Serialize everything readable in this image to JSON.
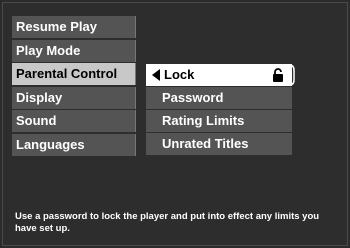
{
  "main_menu": {
    "items": [
      {
        "label": "Resume Play"
      },
      {
        "label": "Play Mode"
      },
      {
        "label": "Parental Control",
        "active": true
      },
      {
        "label": "Display"
      },
      {
        "label": "Sound"
      },
      {
        "label": "Languages"
      }
    ]
  },
  "sub_menu": {
    "items": [
      {
        "label": "Lock",
        "selected": true,
        "icon": "lock-icon"
      },
      {
        "label": "Password"
      },
      {
        "label": "Rating Limits"
      },
      {
        "label": "Unrated Titles"
      }
    ]
  },
  "help_text": "Use a password to lock the player and put into effect any limits you have set up.",
  "colors": {
    "background": "#2d2d2d",
    "menu_item": "#545454",
    "menu_active": "#c8c8c8",
    "sub_selected": "#ffffff",
    "text": "#ffffff"
  }
}
